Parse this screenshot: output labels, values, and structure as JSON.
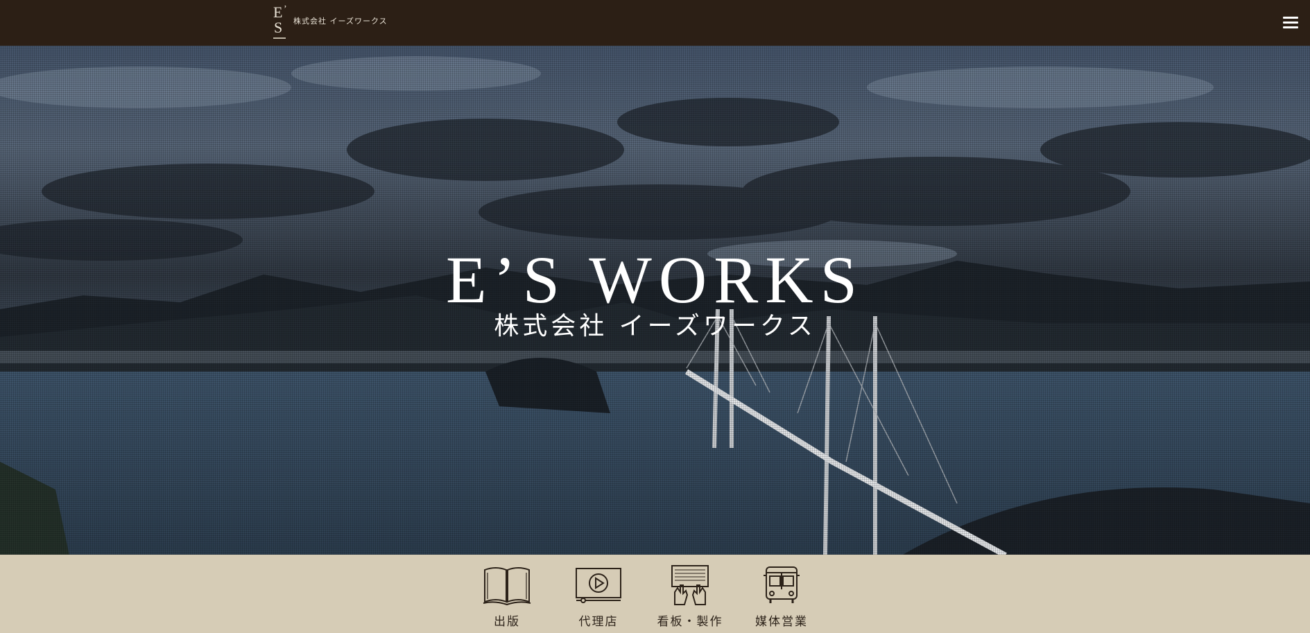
{
  "header": {
    "logo_letters": "E'S",
    "company_name": "株式会社 イーズワークス",
    "menu_icon": "hamburger-menu-icon"
  },
  "hero": {
    "title": "E’S WORKS",
    "subtitle": "株式会社 イーズワークス"
  },
  "services": [
    {
      "label": "出版",
      "icon": "open-book-icon"
    },
    {
      "label": "代理店",
      "icon": "video-play-icon"
    },
    {
      "label": "看板・製作",
      "icon": "hands-keyboard-icon"
    },
    {
      "label": "媒体営業",
      "icon": "bus-icon"
    }
  ],
  "colors": {
    "header_bg": "#2c1f15",
    "service_bar_bg": "#d6ccb6",
    "text_dark": "#2c2219",
    "text_light": "#ffffff"
  }
}
